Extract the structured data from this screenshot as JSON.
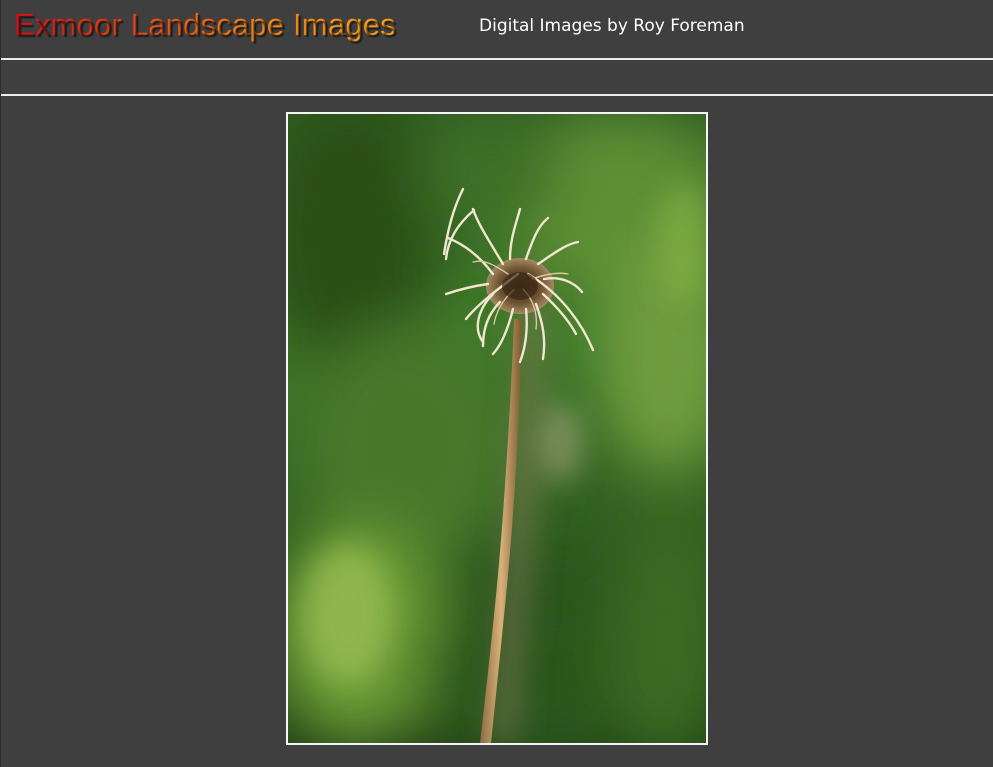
{
  "header": {
    "title": "Exmoor Landscape Images",
    "subtitle": "Digital Images by Roy Foreman"
  },
  "photo": {
    "subject": "dried seed head on a thin stem against a blurred green background"
  },
  "colors": {
    "background": "#3f3f3f",
    "rule": "#ececec",
    "title_gradient_start": "#d4121c",
    "title_gradient_end": "#f7a41c",
    "subtitle": "#ffffff",
    "photo_border": "#f4f4f4"
  }
}
